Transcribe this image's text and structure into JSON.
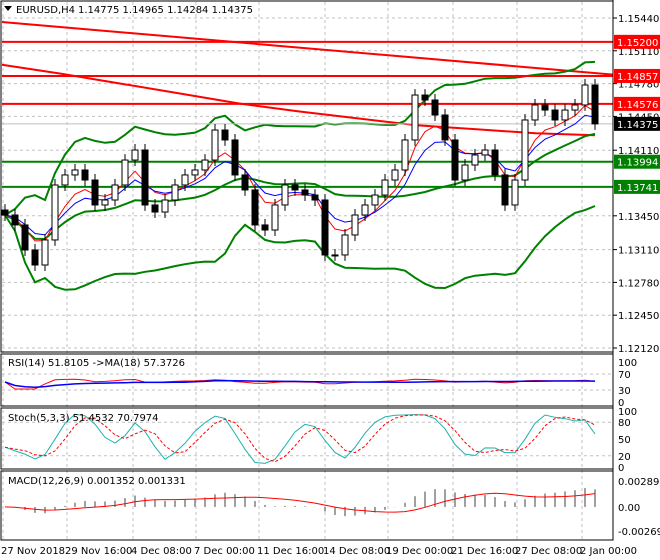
{
  "header": {
    "symbol": "EURUSD,H4",
    "ohlc": "1.14775 1.14965 1.14284 1.14375"
  },
  "chart_data": {
    "type": "candlestick",
    "title": "EURUSD,H4",
    "price_axis": {
      "ticks": [
        "1.15440",
        "1.15110",
        "1.14780",
        "1.14450",
        "1.14110",
        "1.13450",
        "1.13110",
        "1.12780",
        "1.12450",
        "1.12120"
      ],
      "range": [
        1.1212,
        1.1544
      ]
    },
    "time_axis": {
      "ticks": [
        "27 Nov 2018",
        "29 Nov 16:00",
        "4 Dec 08:00",
        "7 Dec 00:00",
        "11 Dec 16:00",
        "14 Dec 08:00",
        "19 Dec 00:00",
        "21 Dec 16:00",
        "27 Dec 08:00",
        "2 Jan 00:00"
      ]
    },
    "closes": [
      1.13458,
      1.13358,
      1.13106,
      1.12955,
      1.13207,
      1.1376,
      1.13861,
      1.13911,
      1.1381,
      1.13559,
      1.13609,
      1.1376,
      1.14011,
      1.14112,
      1.13559,
      1.13488,
      1.13609,
      1.1376,
      1.13861,
      1.13911,
      1.14011,
      1.14313,
      1.14213,
      1.13861,
      1.1371,
      1.13358,
      1.13307,
      1.13559,
      1.1376,
      1.1371,
      1.13659,
      1.13609,
      1.13056,
      1.13056,
      1.13257,
      1.13458,
      1.13559,
      1.13659,
      1.1381,
      1.13911,
      1.14213,
      1.14665,
      1.14615,
      1.14464,
      1.14213,
      1.1381,
      1.13961,
      1.14062,
      1.14112,
      1.13861,
      1.13559,
      1.1381,
      1.14414,
      1.14565,
      1.14514,
      1.14414,
      1.14514,
      1.14565,
      1.14766,
      1.14375
    ],
    "long_ma": [
      1.1497,
      1.1488,
      1.1478,
      1.1468,
      1.1458,
      1.145,
      1.1443,
      1.1436,
      1.1432,
      1.1428,
      1.1426
    ],
    "trendline": [
      1.154,
      1.1487
    ],
    "levels": [
      {
        "price": "1.15200",
        "color": "#ff0000"
      },
      {
        "price": "1.14857",
        "color": "#ff0000"
      },
      {
        "price": "1.14576",
        "color": "#ff0000"
      },
      {
        "price": "1.13994",
        "color": "#008000"
      },
      {
        "price": "1.13741",
        "color": "#008000"
      }
    ],
    "current_price": "1.14375",
    "rsi": {
      "label": "RSI(14) 51.8105  ->MA(18) 57.3726",
      "ticks": [
        "100",
        "70",
        "30",
        "0"
      ]
    },
    "stoch": {
      "label": "Stoch(5,3,3) 51.4532 70.7974",
      "ticks": [
        "100",
        "80",
        "50",
        "20",
        "0"
      ]
    },
    "macd": {
      "label": "MACD(12,26,9) 0.001352 0.001331",
      "ticks": [
        "0.002896",
        "0.00",
        "-0.002693"
      ],
      "range": [
        -0.002693,
        0.002896
      ]
    }
  },
  "colors": {
    "bull": "#ffffff",
    "bear": "#000000",
    "bands": "#008000",
    "ma_fast": "#ff0000",
    "ma_slow": "#0000ff",
    "signal": "#ff0000",
    "stoch_main": "#20b2aa",
    "hist": "#a0a0a0"
  }
}
